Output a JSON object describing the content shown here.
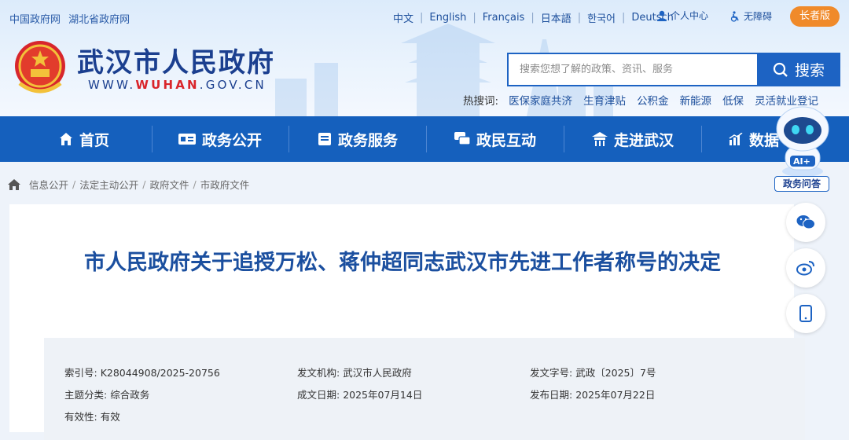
{
  "topbar": {
    "links": [
      "中国政府网",
      "湖北省政府网"
    ],
    "languages": [
      "中文",
      "English",
      "Français",
      "日本語",
      "한국어",
      "Deutsch"
    ],
    "personal_center": "个人中心",
    "accessibility": "无障碍",
    "elder_mode": "长者版"
  },
  "site": {
    "title": "武汉市人民政府",
    "url_prefix": "WWW.",
    "url_highlight": "WUHAN",
    "url_suffix": ".GOV.CN"
  },
  "search": {
    "placeholder": "搜索您想了解的政策、资讯、服务",
    "button_label": "搜索",
    "hot_label": "热搜词:",
    "hot_words": [
      "医保家庭共济",
      "生育津贴",
      "公积金",
      "新能源",
      "低保",
      "灵活就业登记"
    ]
  },
  "nav": {
    "items": [
      {
        "label": "首页",
        "icon": "home-icon"
      },
      {
        "label": "政务公开",
        "icon": "card-icon"
      },
      {
        "label": "政务服务",
        "icon": "document-icon"
      },
      {
        "label": "政民互动",
        "icon": "chat-icon"
      },
      {
        "label": "走进武汉",
        "icon": "pavilion-icon"
      },
      {
        "label": "数据",
        "icon": "chart-icon"
      }
    ]
  },
  "ai_assistant": {
    "badge": "AI+",
    "label": "政务问答"
  },
  "breadcrumb": [
    "信息公开",
    "法定主动公开",
    "政府文件",
    "市政府文件"
  ],
  "article": {
    "title": "市人民政府关于追授万松、蒋仲超同志武汉市先进工作者称号的决定",
    "meta": {
      "index_label": "索引号:",
      "index_value": "K28044908/2025-20756",
      "issuer_label": "发文机构:",
      "issuer_value": "武汉市人民政府",
      "doc_no_label": "发文字号:",
      "doc_no_value": "武政〔2025〕7号",
      "category_label": "主题分类:",
      "category_value": "综合政务",
      "written_label": "成文日期:",
      "written_value": "2025年07月14日",
      "publish_label": "发布日期:",
      "publish_value": "2025年07月22日",
      "validity_label": "有效性:",
      "validity_value": "有效"
    }
  },
  "colors": {
    "nav_bg": "#1560bd",
    "title_blue": "#1b4f9f",
    "elder_orange": "#f08a2a"
  }
}
